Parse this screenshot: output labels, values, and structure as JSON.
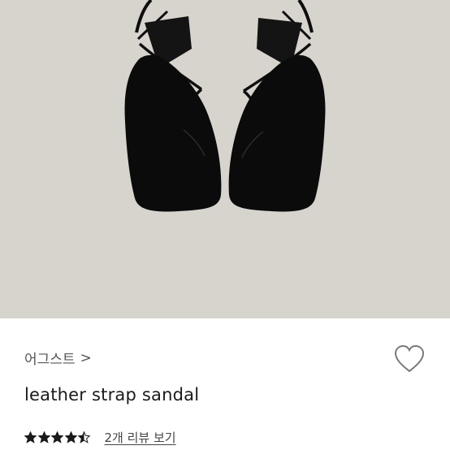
{
  "product": {
    "brand": "어그스트",
    "brand_chevron": ">",
    "name": "leather strap sandal",
    "rating": 4.5,
    "rating_max": 5,
    "review_link": "2개 리뷰 보기"
  },
  "icons": {
    "heart": "heart-outline-icon",
    "star": "star-icon"
  },
  "colors": {
    "image_background": "#d7d4cd",
    "sandal": "#0e0e0e",
    "star": "#1a1a1a",
    "heart_outline": "#7a7a7a"
  }
}
